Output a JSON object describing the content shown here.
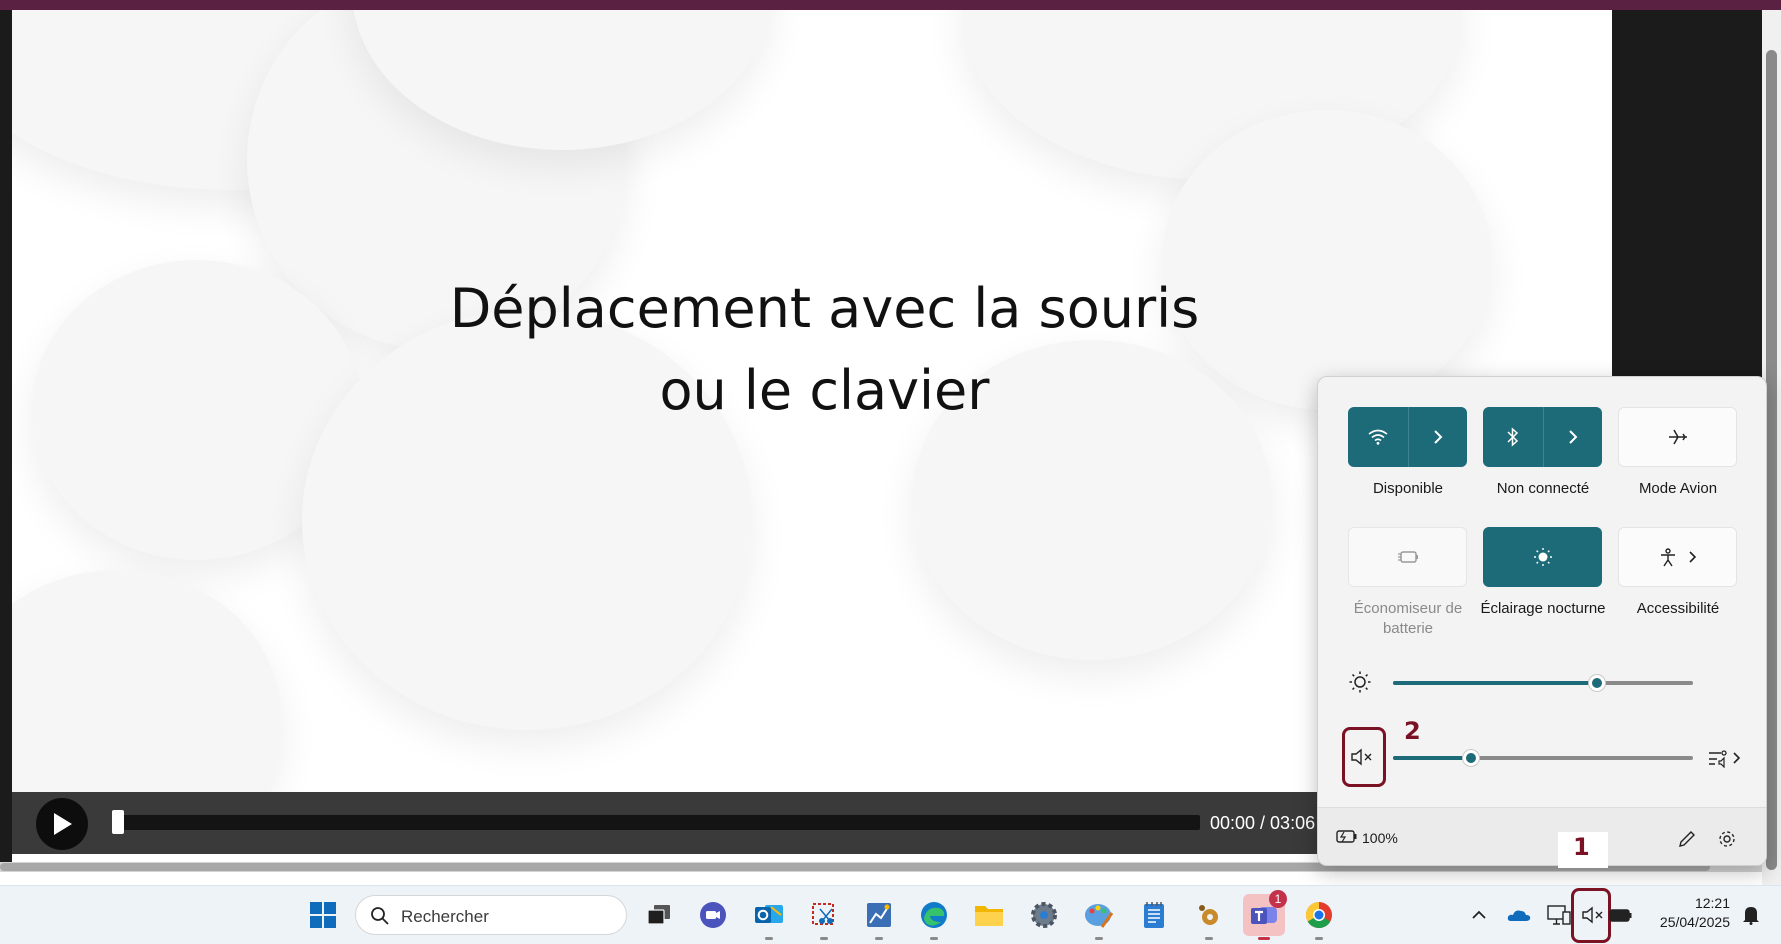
{
  "slide": {
    "line1": "Déplacement avec la souris",
    "line2": "ou le clavier"
  },
  "player": {
    "time": "00:00 / 03:06",
    "progress": 0
  },
  "quick_settings": {
    "tiles": [
      {
        "label": "Disponible",
        "icon": "wifi-icon",
        "state": "on"
      },
      {
        "label": "Non connecté",
        "icon": "bluetooth-icon",
        "state": "on"
      },
      {
        "label": "Mode Avion",
        "icon": "airplane-icon",
        "state": "off"
      },
      {
        "label": "Économiseur de batterie",
        "icon": "battery-saver-icon",
        "state": "disabled"
      },
      {
        "label": "Éclairage nocturne",
        "icon": "night-light-icon",
        "state": "on"
      },
      {
        "label": "Accessibilité",
        "icon": "accessibility-icon",
        "state": "off"
      }
    ],
    "brightness_level": 0.68,
    "volume_level": 0.26,
    "volume_muted": true,
    "battery": "100%"
  },
  "callouts": {
    "first": "1",
    "second": "2"
  },
  "taskbar": {
    "search_placeholder": "Rechercher",
    "time": "12:21",
    "date": "25/04/2025",
    "teams_badge": "1",
    "apps": [
      "windows-start-icon",
      "task-view-icon",
      "meet-now-icon",
      "outlook-icon",
      "snipping-tool-icon",
      "paint-chart-icon",
      "edge-icon",
      "file-explorer-icon",
      "settings-icon",
      "paint-icon",
      "notepad-icon",
      "custom-app-icon",
      "teams-icon",
      "chrome-icon"
    ]
  },
  "colors": {
    "accent": "#1d6a78",
    "callout": "#7a1224",
    "titlebar": "#5a2142"
  }
}
